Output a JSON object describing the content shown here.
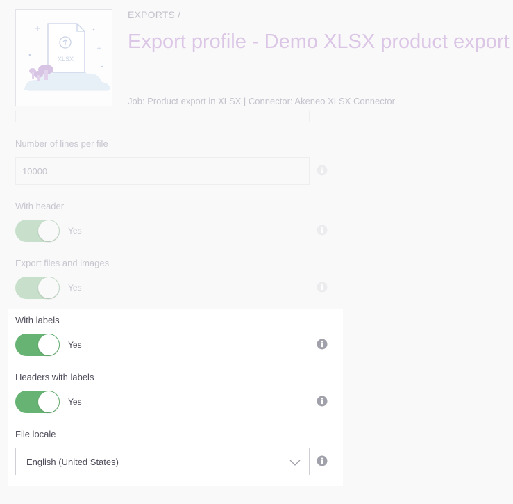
{
  "header": {
    "breadcrumb": "EXPORTS /",
    "title": "Export profile - Demo XLSX product export",
    "meta": "Job: Product export in XLSX | Connector: Akeneo XLSX Connector",
    "thumbnail_caption": "XLSX"
  },
  "fields": {
    "lines_per_file": {
      "label": "Number of lines per file",
      "value": "10000"
    },
    "with_header": {
      "label": "With header",
      "state": "Yes"
    },
    "export_files": {
      "label": "Export files and images",
      "state": "Yes"
    },
    "with_labels": {
      "label": "With labels",
      "state": "Yes"
    },
    "headers_with_labels": {
      "label": "Headers with labels",
      "state": "Yes"
    },
    "file_locale": {
      "label": "File locale",
      "value": "English (United States)"
    }
  },
  "icons": {
    "info": "info-icon",
    "chevron": "chevron-down-icon",
    "thumbnail": "xlsx-file-illustration"
  },
  "colors": {
    "toggle_on": "#67b373",
    "title_purple": "#dcc6e6",
    "text_dark": "#4e4d5a",
    "text_faded": "#c8c7cf"
  }
}
